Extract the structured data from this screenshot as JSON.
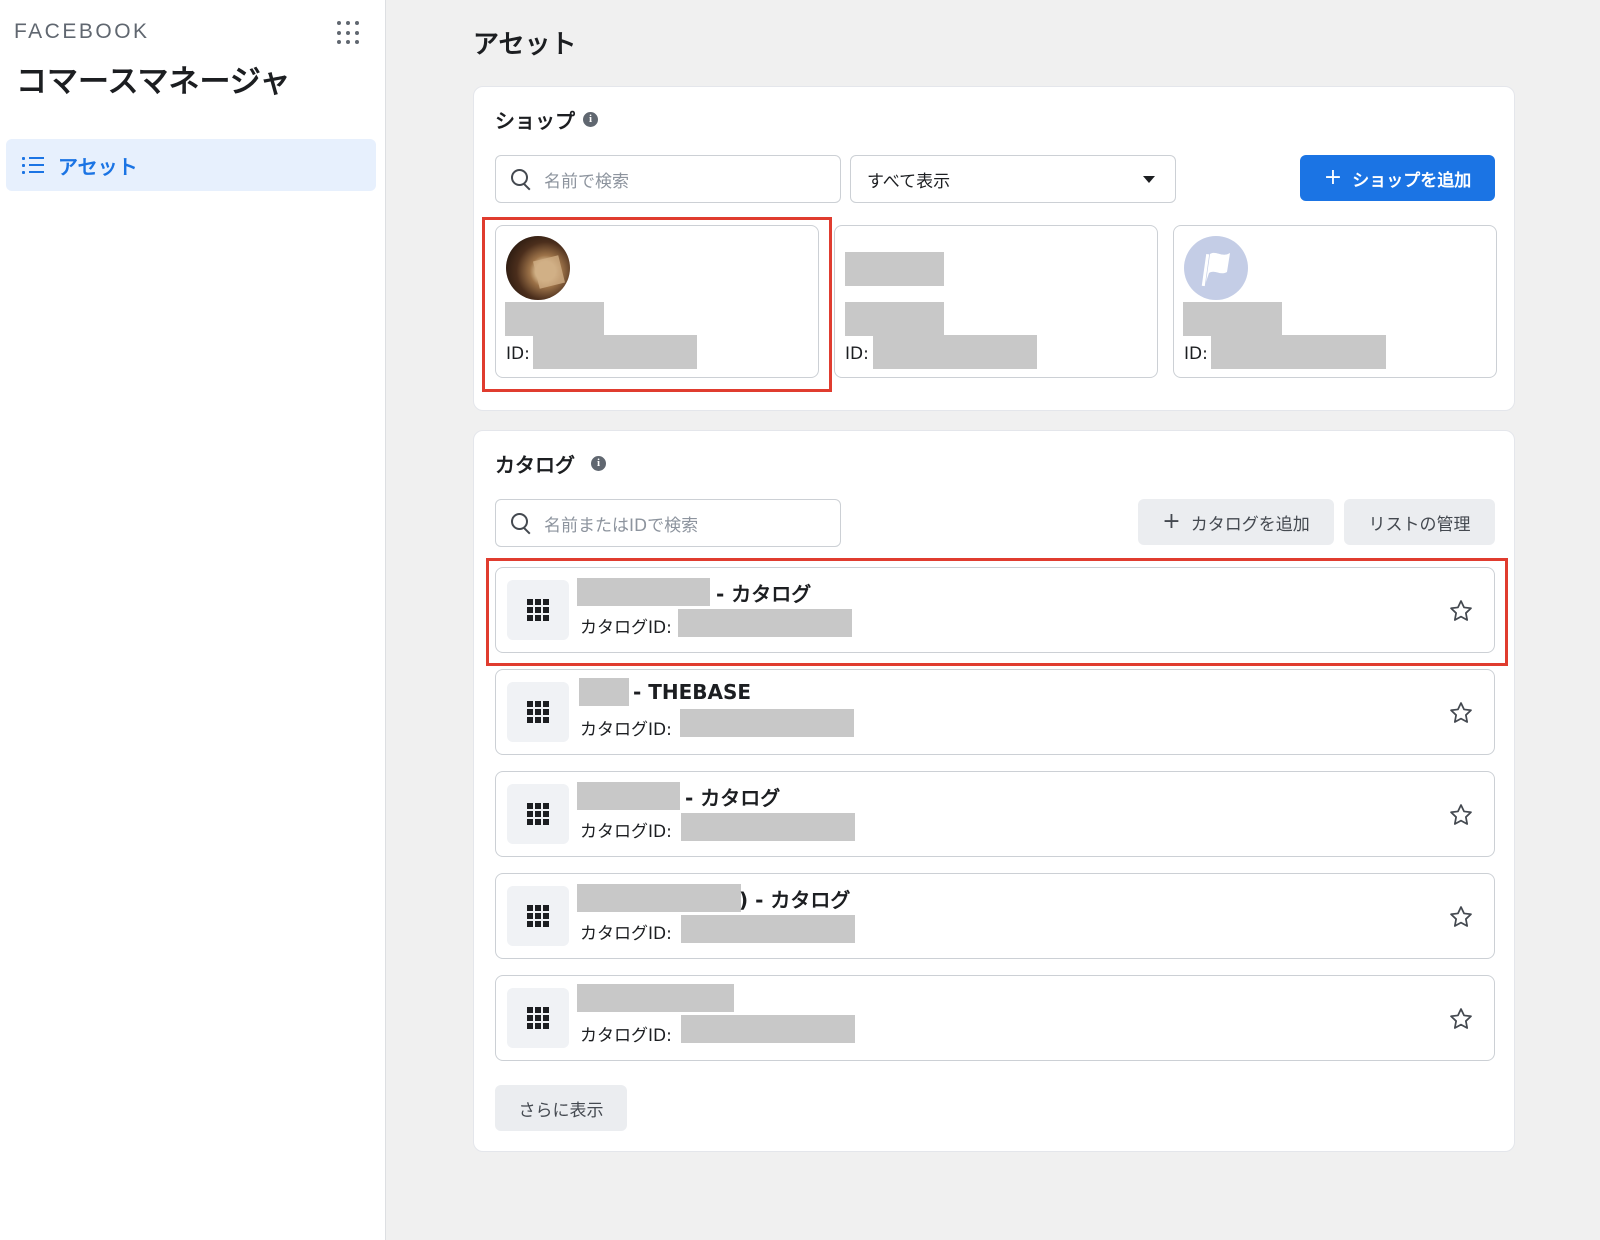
{
  "sidebar": {
    "brand": "FACEBOOK",
    "app_title": "コマースマネージャ",
    "apps_icon": "grid-dots-icon",
    "nav": [
      {
        "label": "アセット",
        "icon": "list-icon",
        "selected": true
      }
    ]
  },
  "main": {
    "page_title": "アセット",
    "shop": {
      "title": "ショップ",
      "search_placeholder": "名前で検索",
      "filter_value": "すべて表示",
      "add_button": "ショップを追加",
      "tiles": [
        {
          "id_label": "ID:",
          "avatar": "shop-photo",
          "highlighted": true
        },
        {
          "id_label": "ID: ",
          "avatar": "none",
          "highlighted": false
        },
        {
          "id_label": "ID:",
          "avatar": "flag-placeholder",
          "highlighted": false
        }
      ]
    },
    "catalog": {
      "title": "カタログ",
      "search_placeholder": "名前またはIDで検索",
      "add_button": "カタログを追加",
      "manage_button": "リストの管理",
      "rows": [
        {
          "name_suffix": "- カタログ",
          "id_label": "カタログID:",
          "highlighted": true
        },
        {
          "name_suffix": "- THEBASE",
          "id_label": "カタログID:",
          "highlighted": false
        },
        {
          "name_suffix": "- カタログ",
          "id_label": "カタログID:",
          "highlighted": false
        },
        {
          "name_suffix": ") - カタログ",
          "id_label": "カタログID: ",
          "highlighted": false
        },
        {
          "name_suffix": "",
          "id_label": "カタログID: ",
          "highlighted": false
        }
      ],
      "more_button": "さらに表示"
    }
  },
  "colors": {
    "accent": "#1b74e4",
    "highlight_box": "#e03c2f",
    "redaction": "#c8c8c8"
  }
}
